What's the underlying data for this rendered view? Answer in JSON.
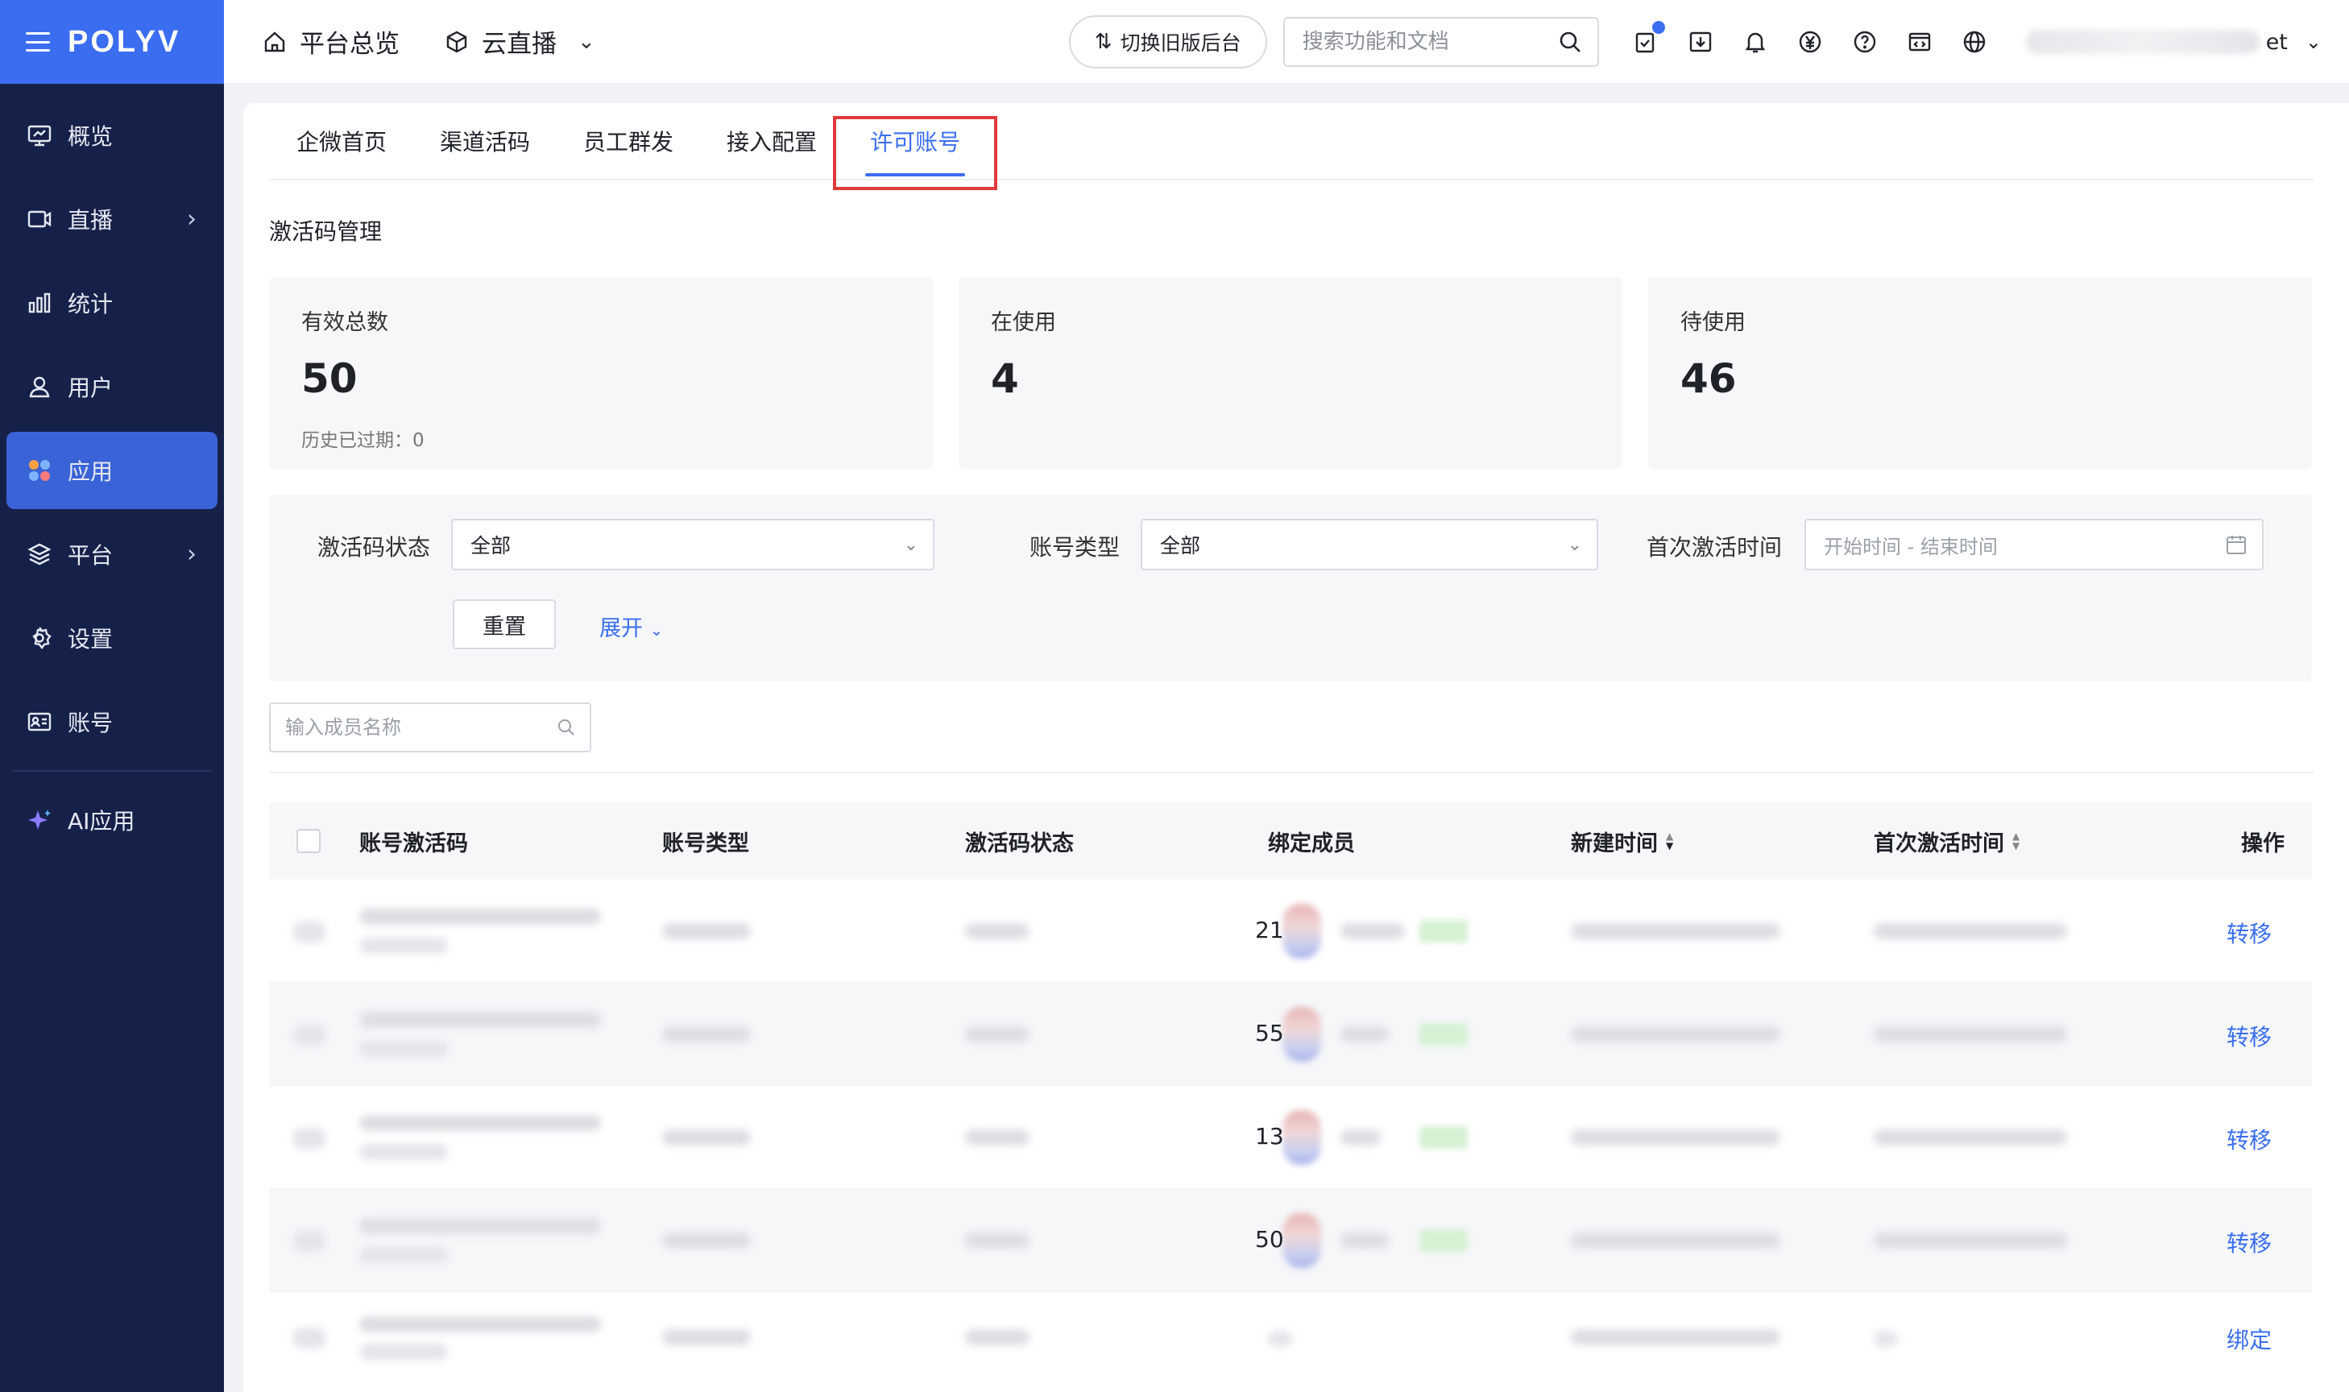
{
  "brand": {
    "logo": "POLYV",
    "accent": "#3a6df0",
    "sidebar_bg": "#16214a"
  },
  "sidebar": {
    "items": [
      {
        "label": "概览",
        "icon": "monitor-icon"
      },
      {
        "label": "直播",
        "icon": "video-icon",
        "has_submenu": true
      },
      {
        "label": "统计",
        "icon": "bar-chart-icon"
      },
      {
        "label": "用户",
        "icon": "user-icon"
      },
      {
        "label": "应用",
        "icon": "apps-icon",
        "active": true
      },
      {
        "label": "平台",
        "icon": "layers-icon",
        "has_submenu": true
      },
      {
        "label": "设置",
        "icon": "gear-icon"
      },
      {
        "label": "账号",
        "icon": "id-card-icon"
      },
      {
        "label": "AI应用",
        "icon": "sparkle-icon"
      }
    ]
  },
  "topbar": {
    "home_label": "平台总览",
    "product_label": "云直播",
    "switch_label": "切换旧版后台",
    "search_placeholder": "搜索功能和文档",
    "account_suffix": "et"
  },
  "tabs": [
    "企微首页",
    "渠道活码",
    "员工群发",
    "接入配置",
    "许可账号"
  ],
  "active_tab": "许可账号",
  "section_title": "激活码管理",
  "stats": [
    {
      "label": "有效总数",
      "value": "50",
      "sub": "历史已过期：0"
    },
    {
      "label": "在使用",
      "value": "4"
    },
    {
      "label": "待使用",
      "value": "46"
    }
  ],
  "filters": {
    "status_label": "激活码状态",
    "status_value": "全部",
    "type_label": "账号类型",
    "type_value": "全部",
    "time_label": "首次激活时间",
    "time_placeholder": "开始时间 - 结束时间",
    "reset_label": "重置",
    "expand_label": "展开"
  },
  "member_search_placeholder": "输入成员名称",
  "table": {
    "columns": [
      "账号激活码",
      "账号类型",
      "激活码状态",
      "绑定成员",
      "新建时间",
      "首次激活时间",
      "操作"
    ],
    "rows": [
      {
        "time_tail": "21",
        "action": "转移"
      },
      {
        "time_tail": "55",
        "action": "转移"
      },
      {
        "time_tail": "13",
        "action": "转移"
      },
      {
        "time_tail": "50",
        "action": "转移"
      },
      {
        "time_tail": "",
        "action": "绑定"
      }
    ]
  }
}
